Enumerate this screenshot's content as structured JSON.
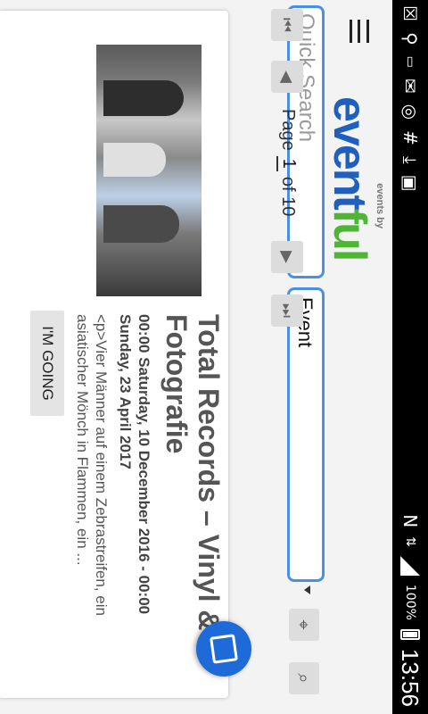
{
  "status_bar": {
    "battery": "100%",
    "time": "13:56",
    "icons": [
      "close-notification-icon",
      "usb-icon",
      "sd-card-icon",
      "mail-icon",
      "wifi-icon",
      "hash-icon",
      "download-icon",
      "photo-icon",
      "nfc-icon",
      "data-arrows-icon",
      "signal-icon",
      "battery-icon"
    ]
  },
  "header": {
    "logo_top": "events by",
    "logo_part1": "event",
    "logo_part2": "ful",
    "search_placeholder": "Quick Search",
    "category_value": "Event"
  },
  "pager": {
    "page_label": "Page",
    "page_value": "1",
    "of_label": "of 10"
  },
  "event": {
    "title": "Total Records – Vinyl & Fotografie",
    "dates": "00:00 Saturday, 10 December 2016 - 00:00 Sunday, 23 April 2017",
    "description": "<p>Vier Männer auf einem Zebrastreifen, ein asiatischer Mönch in Flammen, ein ...",
    "going_label": "I'M GOING"
  },
  "colors": {
    "accent": "#4a90e2",
    "logo_event": "#1f5fbd",
    "logo_ful": "#4db634",
    "fab": "#1e6ad9"
  }
}
